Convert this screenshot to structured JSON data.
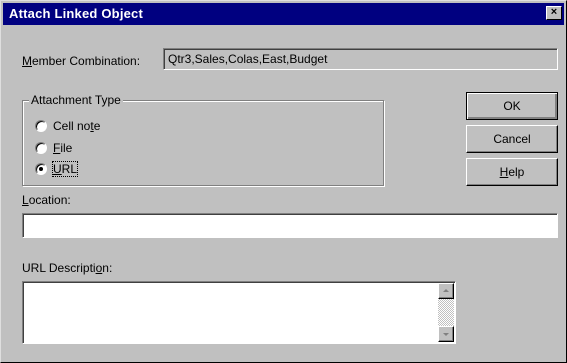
{
  "window": {
    "title": "Attach Linked Object",
    "close_glyph": "×"
  },
  "member": {
    "label": "Member Combination:",
    "value": "Qtr3,Sales,Colas,East,Budget"
  },
  "attachment_type": {
    "caption": "Attachment Type",
    "options": [
      {
        "label": "Cell note",
        "checked": false
      },
      {
        "label": "File",
        "checked": false
      },
      {
        "label": "URL",
        "checked": true
      }
    ]
  },
  "buttons": {
    "ok": "OK",
    "cancel": "Cancel",
    "help": "Help"
  },
  "location": {
    "label": "Location:",
    "value": ""
  },
  "url_description": {
    "label": "URL Description:",
    "value": ""
  },
  "icons": {
    "close": "close-icon",
    "scroll_up": "arrow-up-icon",
    "scroll_down": "arrow-down-icon"
  },
  "colors": {
    "titlebar": "#000080",
    "face": "#c0c0c0"
  }
}
